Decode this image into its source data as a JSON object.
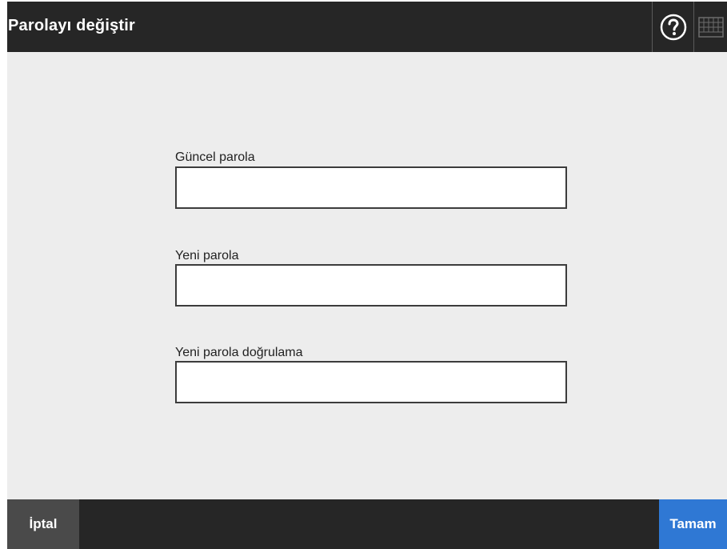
{
  "header": {
    "title": "Parolayı değiştir",
    "help_icon": "help-icon",
    "keyboard_icon": "keyboard-icon"
  },
  "form": {
    "fields": [
      {
        "label": "Güncel parola",
        "value": ""
      },
      {
        "label": "Yeni parola",
        "value": ""
      },
      {
        "label": "Yeni parola doğrulama",
        "value": ""
      }
    ]
  },
  "footer": {
    "cancel_label": "İptal",
    "ok_label": "Tamam"
  },
  "colors": {
    "titlebar": "#262626",
    "content_bg": "#ededed",
    "cancel_bg": "#4a4a4a",
    "ok_bg": "#2f78d4"
  }
}
